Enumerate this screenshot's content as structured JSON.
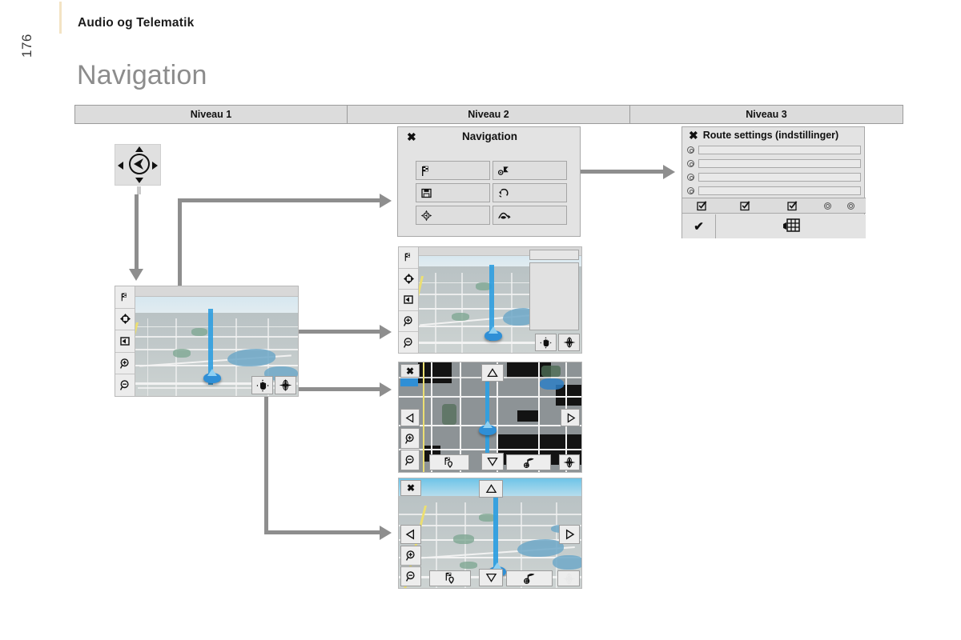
{
  "header": {
    "section_title": "Audio og Telematik",
    "page_number": "176",
    "doc_title": "Navigation"
  },
  "levels": [
    {
      "label": "Niveau 1"
    },
    {
      "label": "Niveau 2"
    },
    {
      "label": "Niveau 3"
    }
  ],
  "joystick": {
    "name": "directional-joystick",
    "center_icon": "navigation-arrow-icon",
    "up_icon": "triangle-up-icon",
    "down_icon": "triangle-down-icon",
    "left_icon": "triangle-left-icon",
    "right_icon": "triangle-right-icon"
  },
  "nav_panel": {
    "title": "Navigation",
    "close_label": "✖",
    "buttons": [
      {
        "icon": "checkered-flag-icon",
        "label": ""
      },
      {
        "icon": "route-settings-icon",
        "label": ""
      },
      {
        "icon": "save-floppy-icon",
        "label": ""
      },
      {
        "icon": "traffic-info-icon",
        "label": ""
      },
      {
        "icon": "compass-position-icon",
        "label": ""
      },
      {
        "icon": "route-preview-icon",
        "label": ""
      }
    ]
  },
  "route_panel": {
    "title": "Route settings (indstillinger)",
    "close_label": "✖",
    "option_rows": [
      {
        "radio": "radio-option-icon",
        "field_value": ""
      },
      {
        "radio": "radio-option-icon",
        "field_value": ""
      },
      {
        "radio": "radio-option-icon",
        "field_value": ""
      },
      {
        "radio": "radio-option-icon",
        "field_value": ""
      }
    ],
    "toolbar": [
      {
        "icon": "checkbox-checked-icon"
      },
      {
        "icon": "checkbox-checked-icon"
      },
      {
        "icon": "checkbox-checked-icon"
      },
      {
        "icon": "radio-option-icon"
      },
      {
        "icon": "radio-option-icon"
      }
    ],
    "confirm_label": "✔",
    "bottom_icon": "map-grid-hand-icon"
  },
  "screens": {
    "map_3d_level1": {
      "name": "map-screen-3d-guidance",
      "sidebar": [
        {
          "icon": "checkered-flag-icon"
        },
        {
          "icon": "pan-move-icon"
        },
        {
          "icon": "exit-arrow-icon"
        },
        {
          "icon": "zoom-in-icon"
        },
        {
          "icon": "zoom-out-icon"
        }
      ],
      "bottom_right_buttons": [
        {
          "icon": "hand-pan-icon"
        },
        {
          "icon": "compass-icon"
        }
      ]
    },
    "map_with_list": {
      "name": "map-screen-with-side-list",
      "sidebar": [
        {
          "icon": "checkered-flag-icon"
        },
        {
          "icon": "pan-move-icon"
        },
        {
          "icon": "exit-arrow-icon"
        },
        {
          "icon": "zoom-in-icon"
        },
        {
          "icon": "zoom-out-icon"
        }
      ],
      "side_panel_field": "",
      "bottom_right_buttons": [
        {
          "icon": "hand-pan-icon"
        },
        {
          "icon": "compass-icon"
        }
      ]
    },
    "map_2d_pan": {
      "name": "map-screen-2d-pan",
      "close_label": "✖",
      "sidebar": [
        {
          "icon": "arrow-left-icon"
        },
        {
          "icon": "zoom-in-icon"
        },
        {
          "icon": "zoom-out-icon"
        }
      ],
      "pan_up_icon": "triangle-up-outline-icon",
      "pan_down_icon": "triangle-down-outline-icon",
      "pan_left_icon": "triangle-left-outline-icon",
      "pan_right_icon": "triangle-right-outline-icon",
      "bottom_buttons": [
        {
          "icon": "poi-flag-icon"
        },
        {
          "icon": "destination-flag-icon"
        },
        {
          "icon": "compass-icon"
        }
      ]
    },
    "map_3d_pan": {
      "name": "map-screen-3d-pan",
      "close_label": "✖",
      "sidebar": [
        {
          "icon": "arrow-left-icon"
        },
        {
          "icon": "zoom-in-icon"
        },
        {
          "icon": "zoom-out-icon"
        }
      ],
      "pan_up_icon": "triangle-up-outline-icon",
      "pan_down_icon": "triangle-down-outline-icon",
      "pan_left_icon": "triangle-left-outline-icon",
      "pan_right_icon": "triangle-right-outline-icon",
      "bottom_buttons": [
        {
          "icon": "poi-flag-icon"
        },
        {
          "icon": "destination-flag-icon"
        },
        {
          "icon": "compass-icon"
        }
      ]
    }
  },
  "connectors": {
    "arrow_color": "#8e8e8e",
    "items": [
      {
        "name": "joystick-to-map-arrow",
        "direction": "down"
      },
      {
        "name": "map-to-navigation-menu-arrow",
        "direction": "right"
      },
      {
        "name": "navigation-menu-to-route-settings-arrow",
        "direction": "right"
      },
      {
        "name": "map-to-list-map-arrow",
        "direction": "right"
      },
      {
        "name": "map-to-2d-pan-arrow",
        "direction": "right"
      },
      {
        "name": "map-to-3d-pan-arrow",
        "direction": "right"
      }
    ]
  },
  "colors": {
    "accent_rule": "#f3e3c4",
    "title_grey": "#8c8c8c",
    "panel_bg": "#e3e3e3",
    "arrow_grey": "#8e8e8e",
    "route_blue": "#2f9fe0"
  }
}
